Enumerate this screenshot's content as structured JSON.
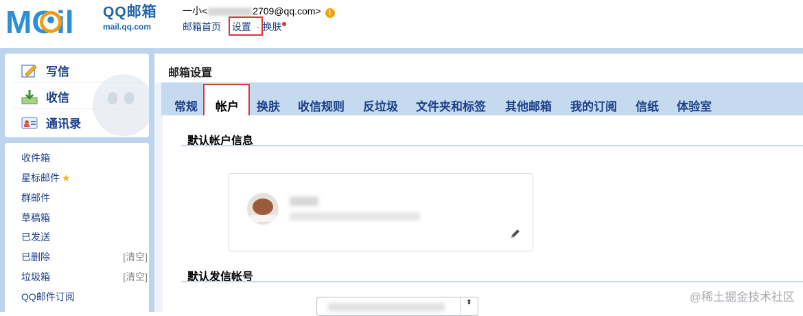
{
  "brand": {
    "logo_text": "MOil",
    "name_cn": "QQ邮箱",
    "url": "mail.qq.com"
  },
  "account": {
    "display_name": "一小<",
    "email_suffix": "2709@qq.com>",
    "warn_icon": "!"
  },
  "topnav": {
    "home": "邮箱首页",
    "settings": "设置",
    "separator": "-",
    "skin": "换肤"
  },
  "sidebar": {
    "compose": "写信",
    "inbox": "收信",
    "contacts": "通讯录",
    "folders": [
      {
        "label": "收件箱"
      },
      {
        "label": "星标邮件",
        "icon": "star-icon"
      },
      {
        "label": "群邮件"
      },
      {
        "label": "草稿箱"
      },
      {
        "label": "已发送"
      },
      {
        "label": "已删除",
        "action": "[清空]"
      },
      {
        "label": "垃圾箱",
        "action": "[清空]"
      },
      {
        "label": "QQ邮件订阅"
      }
    ]
  },
  "settings": {
    "title": "邮箱设置",
    "tabs": [
      "常规",
      "帐户",
      "换肤",
      "收信规则",
      "反垃圾",
      "文件夹和标签",
      "其他邮箱",
      "我的订阅",
      "信纸",
      "体验室"
    ],
    "active_tab": "帐户",
    "section_account": "默认帐户信息",
    "section_sender": "默认发信帐号",
    "select_arrows": "⬍"
  },
  "watermark": "@稀土掘金技术社区",
  "colors": {
    "accent_blue": "#1a3f8a",
    "frame_blue": "#bcd4ee",
    "highlight_red": "#d93838"
  }
}
